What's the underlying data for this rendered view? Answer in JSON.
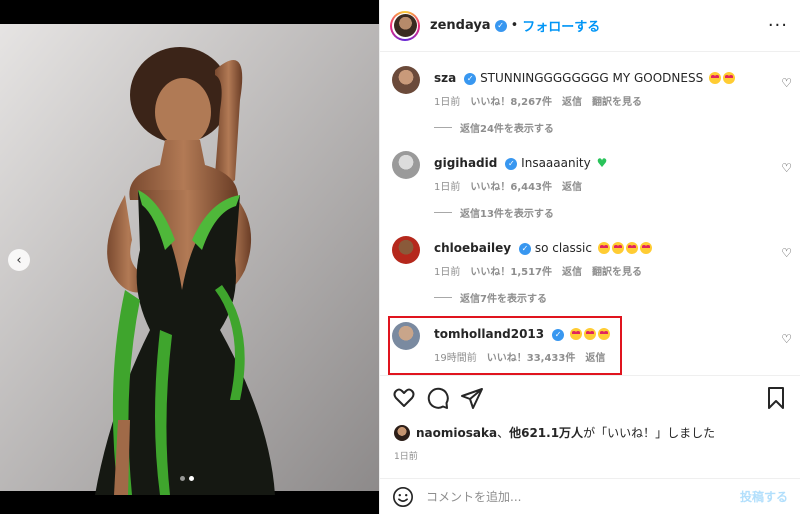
{
  "header": {
    "username": "zendaya",
    "separator": "•",
    "follow_label": "フォローする",
    "more_label": "···"
  },
  "comments": [
    {
      "user": "sza",
      "text": "STUNNINGGGGGGGG MY GOODNESS",
      "emoji_count": 2,
      "time": "1日前",
      "likes": "いいね！8,267件",
      "reply_label": "返信",
      "translate_label": "翻訳を見る",
      "view_replies": "返信24件を表示する",
      "avatar_color": "#6b4a3a"
    },
    {
      "user": "gigihadid",
      "text": "Insaaaanity",
      "time": "1日前",
      "likes": "いいね！6,443件",
      "reply_label": "返信",
      "view_replies": "返信13件を表示する",
      "avatar_color": "#9a9a9a"
    },
    {
      "user": "chloebailey",
      "text": "so classic",
      "emoji_count": 4,
      "time": "1日前",
      "likes": "いいね！1,517件",
      "reply_label": "返信",
      "translate_label": "翻訳を見る",
      "view_replies": "返信7件を表示する",
      "avatar_color": "#b5281c"
    },
    {
      "user": "tomholland2013",
      "text": "",
      "emoji_count": 3,
      "time": "19時間前",
      "likes": "いいね！33,433件",
      "reply_label": "返信",
      "avatar_color": "#7a8aa0"
    }
  ],
  "likes_summary": {
    "user": "naomiosaka",
    "middle": "、",
    "count": "他621.1万人",
    "suffix": "が「いいね！」しました"
  },
  "timestamp": "1日前",
  "add_comment": {
    "placeholder": "コメントを追加...",
    "post_label": "投稿する"
  },
  "carousel": {
    "prev_label": "‹",
    "total_slides": 2,
    "active_slide": 2
  },
  "colors": {
    "accent": "#0095f6",
    "highlight_box": "#e0141e",
    "verified": "#3897f0"
  }
}
